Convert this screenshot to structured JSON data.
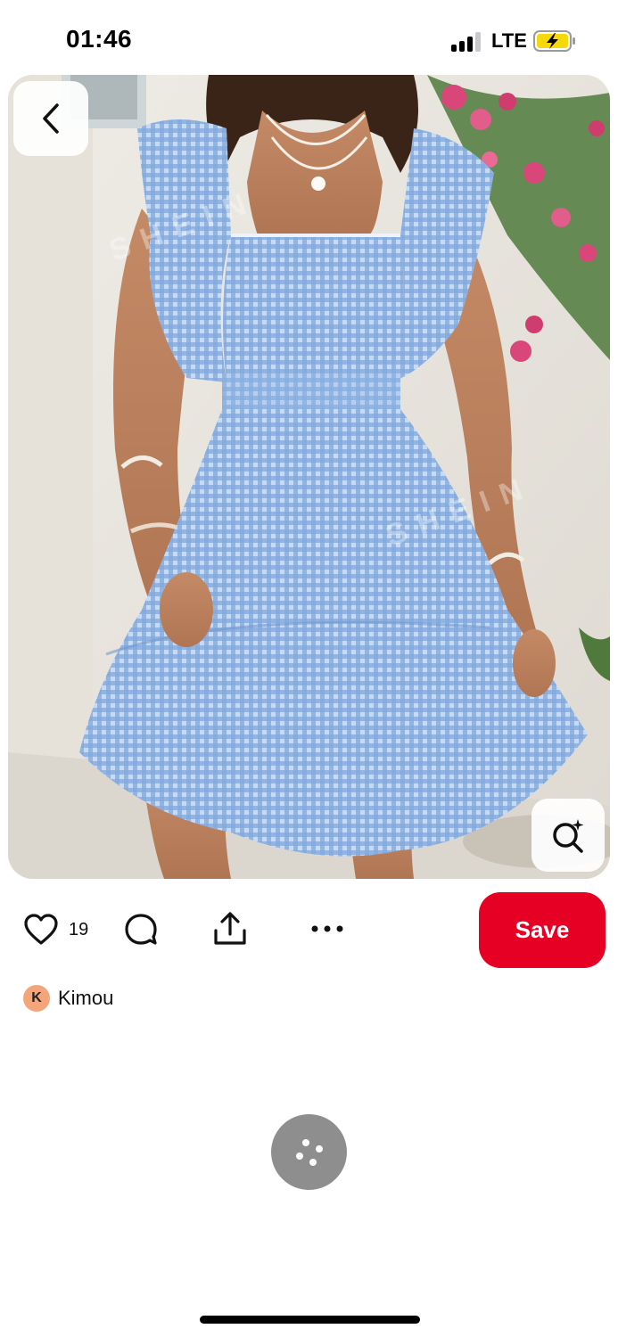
{
  "status_bar": {
    "time": "01:46",
    "network": "LTE"
  },
  "pin": {
    "image_alt": "Blue gingham ruffle sleeve dress",
    "watermark": "SHEIN",
    "like_count": "19",
    "save_label": "Save",
    "author": {
      "initial": "K",
      "name": "Kimou"
    }
  },
  "colors": {
    "save_button": "#e60023",
    "dress_blue": "#8fb3e0",
    "fab_gray": "#8e8e8e"
  },
  "icons": {
    "back": "chevron-left-icon",
    "visual_search": "visual-search-icon",
    "like": "heart-icon",
    "comment": "comment-icon",
    "share": "share-icon",
    "more": "more-horizontal-icon",
    "fab": "dots-menu-icon"
  }
}
